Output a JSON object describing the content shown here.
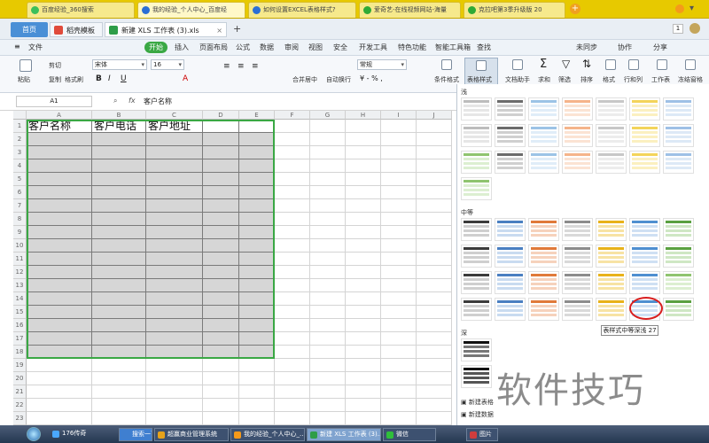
{
  "browser_tabs": [
    {
      "label": "百度经验_360搜索",
      "color": "#3bbf5a"
    },
    {
      "label": "我的经验_个人中心_百度经",
      "color": "#2b6fd6"
    },
    {
      "label": "如何设置EXCEL表格样式?",
      "color": "#2b6fd6"
    },
    {
      "label": "爱奇艺-在线视频网站-海量",
      "color": "#2faa35"
    },
    {
      "label": "克拉吧第3季升级版 20",
      "color": "#2faa35"
    }
  ],
  "wps": {
    "home": "首页",
    "template_tab": "稻壳模板",
    "doc_tab": "新建 XLS 工作表 (3).xls",
    "badge": "1"
  },
  "ribbon_tabs": [
    "文件",
    "开始",
    "插入",
    "页面布局",
    "公式",
    "数据",
    "审阅",
    "视图",
    "安全",
    "开发工具",
    "特色功能",
    "智能工具箱",
    "查找"
  ],
  "ribbon_right": [
    "未同步",
    "协作",
    "分享"
  ],
  "ribbon": {
    "paste": "粘贴",
    "cut": "剪切",
    "copy": "复制",
    "format_painter": "格式刷",
    "font": "宋体",
    "size": "16",
    "merge": "合并居中",
    "wrap": "自动换行",
    "number": "常规",
    "cond_format": "条件格式",
    "table_style": "表格样式",
    "doc_helper": "文档助手",
    "sum": "求和",
    "filter": "筛选",
    "sort": "排序",
    "format": "格式",
    "row_col": "行和列",
    "sheet": "工作表",
    "freeze": "冻结窗格"
  },
  "formula_bar": {
    "name": "A1",
    "fx": "fx",
    "value": "客户名称"
  },
  "grid": {
    "columns": [
      "A",
      "B",
      "C",
      "D",
      "E",
      "F",
      "G",
      "H",
      "I",
      "J"
    ],
    "rows": [
      "1",
      "2",
      "3",
      "4",
      "5",
      "6",
      "7",
      "8",
      "9",
      "10",
      "11",
      "12",
      "13",
      "14",
      "15",
      "16",
      "17",
      "18",
      "19",
      "20",
      "21",
      "22",
      "23"
    ],
    "header_cells": [
      "客户名称",
      "客户电话",
      "客户地址"
    ]
  },
  "panel": {
    "section_light": "浅",
    "section_medium": "中等",
    "section_dark": "深",
    "tooltip": "表样式中等深浅 27",
    "new_table_style": "新建表格",
    "new_data_style": "新建数据"
  },
  "taskbar": [
    {
      "label": "176传奇"
    },
    {
      "label": "搜索一下"
    },
    {
      "label": "超赢商业管理系统"
    },
    {
      "label": "我的经验_个人中心_..."
    },
    {
      "label": "新建 XLS 工作表 (3)..."
    },
    {
      "label": "微信"
    },
    {
      "label": "图片"
    }
  ],
  "watermark": "软件技巧"
}
